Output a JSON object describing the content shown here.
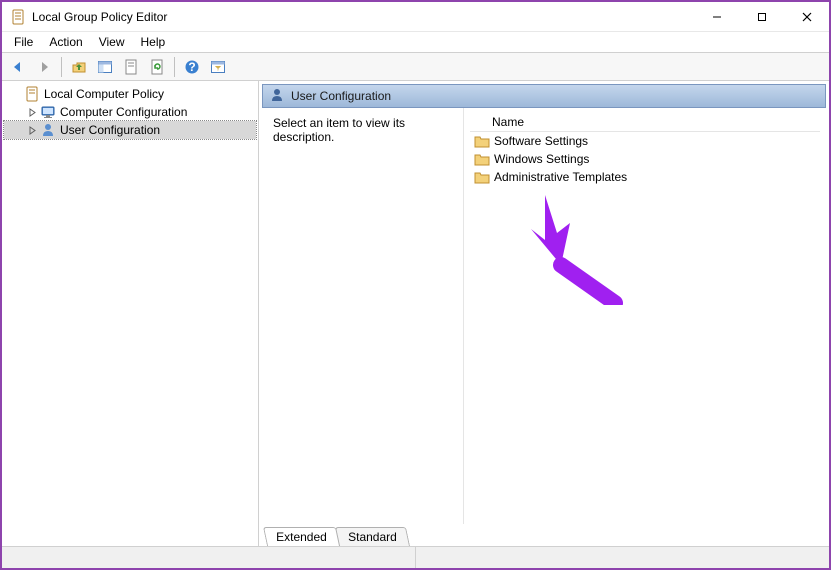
{
  "titlebar": {
    "title": "Local Group Policy Editor"
  },
  "menubar": [
    "File",
    "Action",
    "View",
    "Help"
  ],
  "tree": {
    "root": "Local Computer Policy",
    "children": [
      "Computer Configuration",
      "User Configuration"
    ],
    "selected": "User Configuration"
  },
  "detail": {
    "heading": "User Configuration",
    "description": "Select an item to view its description.",
    "column_header": "Name",
    "items": [
      "Software Settings",
      "Windows Settings",
      "Administrative Templates"
    ]
  },
  "tabs": {
    "extended": "Extended",
    "standard": "Standard"
  }
}
